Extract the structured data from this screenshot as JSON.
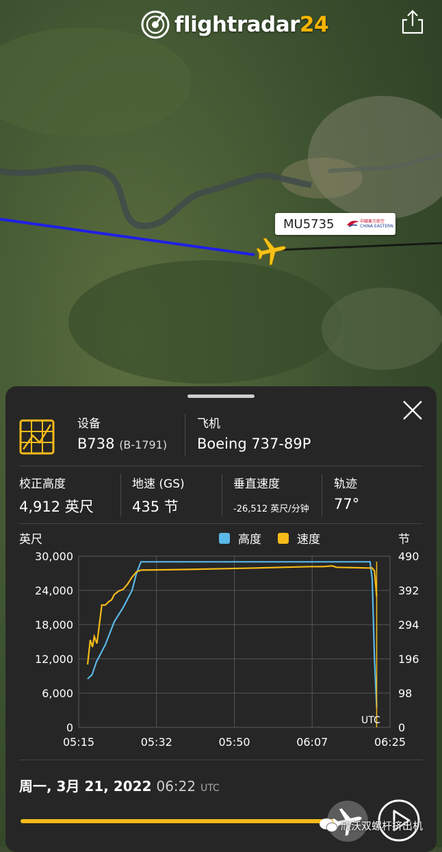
{
  "header": {
    "logo_text": "flightradar",
    "logo_number": "24",
    "share_icon": "share-icon"
  },
  "map": {
    "flight_label": "MU5735",
    "airline_logo_cn": "中國東方航空",
    "airline_logo_en": "CHINA EASTERN",
    "track_color": "#1f1fe6",
    "plane_color": "#f6c21a"
  },
  "panel": {
    "equipment_label": "设备",
    "equipment_value": "B738",
    "registration": "(B-1791)",
    "aircraft_label": "飞机",
    "aircraft_value": "Boeing 737-89P",
    "altitude_label": "校正高度",
    "altitude_value": "4,912 英尺",
    "speed_label": "地速 (GS)",
    "speed_value": "435 节",
    "vs_label": "垂直速度",
    "vs_value": "-26,512 英尺/分钟",
    "track_label": "轨迹",
    "track_value": "77°",
    "date_text": "周一, 3月 21, 2022",
    "time_text": "06:22",
    "time_unit": "UTC",
    "playback_progress": 0.95
  },
  "watermark": "欣沃双螺杆挤出机",
  "chart_data": {
    "type": "line",
    "left_unit": "英尺",
    "right_unit": "节",
    "utc_label": "UTC",
    "legend": [
      {
        "name": "高度",
        "color": "#5bb9e8"
      },
      {
        "name": "速度",
        "color": "#f6bb19"
      }
    ],
    "y_left_ticks": [
      "0",
      "6,000",
      "12,000",
      "18,000",
      "24,000",
      "30,000"
    ],
    "y_right_ticks": [
      "0",
      "98",
      "196",
      "294",
      "392",
      "490"
    ],
    "x_ticks": [
      "05:15",
      "05:32",
      "05:50",
      "06:07",
      "06:25"
    ],
    "ylim_left": [
      0,
      30000
    ],
    "ylim_right": [
      0,
      490
    ],
    "xlim_minutes": [
      0,
      70
    ],
    "series": [
      {
        "name": "高度",
        "x_minutes": [
          2,
          3,
          4,
          5,
          6,
          7,
          8,
          10,
          12,
          13,
          14,
          65.5,
          66,
          66.5,
          67
        ],
        "values": [
          8500,
          9200,
          11500,
          13000,
          14500,
          16500,
          18500,
          21000,
          24000,
          27000,
          29000,
          29000,
          26000,
          12000,
          3500
        ]
      },
      {
        "name": "速度",
        "x_minutes": [
          2,
          2.6,
          3.1,
          3.5,
          4.1,
          4.7,
          5.2,
          6.0,
          6.8,
          7.4,
          8.0,
          9.0,
          10.0,
          11.0,
          12.0,
          13.0,
          14.0,
          25,
          40,
          52,
          55,
          57,
          58,
          65,
          66,
          66.5,
          67
        ],
        "values": [
          180,
          250,
          230,
          260,
          240,
          300,
          350,
          350,
          360,
          365,
          380,
          390,
          395,
          410,
          430,
          445,
          450,
          452,
          456,
          460,
          460,
          462,
          458,
          456,
          456,
          448,
          375
        ]
      }
    ]
  }
}
